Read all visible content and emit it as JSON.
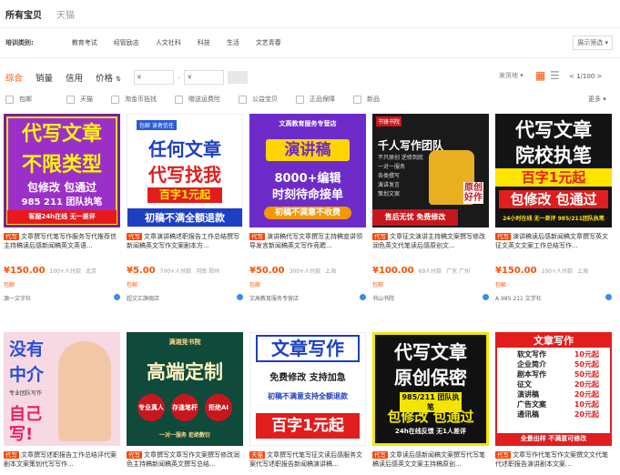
{
  "tabs": [
    "所有宝贝",
    "天猫"
  ],
  "category": {
    "label": "培训类别:",
    "items": [
      "教育考试",
      "经管励志",
      "人文社科",
      "科技",
      "生活",
      "文艺青春"
    ],
    "more": "展示筛选 ▾"
  },
  "sort": {
    "items": [
      "综合",
      "销量",
      "信用",
      "价格"
    ],
    "price_from": "¥",
    "price_to": "¥"
  },
  "shipping_filter": "发货地 ▾",
  "pager": "< 1/100 >",
  "filters": [
    "包邮",
    "天猫",
    "淘金币抵钱",
    "赠送运费险",
    "公益宝贝",
    "正品保障",
    "新品"
  ],
  "filters_more": "更多 ▾",
  "colors": {
    "accent": "#ff5000",
    "blue": "#3a8ee6"
  },
  "products": [
    {
      "img": {
        "l1": "代写文章",
        "l2": "不限类型",
        "l3": "包修改 包通过",
        "l4": "985 211 团队执笔",
        "l5": "客服24h在线    无一差评"
      },
      "ad": "代写",
      "title": "文章撰写代笔写作服务写代推荐信主持稿读后感新闻稿英文英语...",
      "price": "¥150.00",
      "paid": "100+人付款",
      "loc": "北京",
      "ship": "包邮",
      "shop": "源一文字社"
    },
    {
      "img": {
        "tag": "包邮 读者信任",
        "l1": "任何文章",
        "l2": "代写找我",
        "l3": "百字1元起",
        "l4": "初稿不满全额退款"
      },
      "ad": "代写",
      "title": "文章演讲稿述职报告工作总结撰写新闻稿英文写作文案剧本方...",
      "price": "¥5.00",
      "paid": "700+人付款",
      "loc": "河南 郑州",
      "ship": "包邮",
      "shop": "超文汇旗舰店"
    },
    {
      "img": {
        "tag": "文高教育服务专营店",
        "l1": "演讲稿",
        "l2": "8000+编辑",
        "l3": "时刻待命接单",
        "l4": "初稿不满意不收费"
      },
      "ad": "代写",
      "title": "演讲稿代写文章撰写主持稿宣讲领导发言新闻稿英文写作竞聘...",
      "price": "¥50.00",
      "paid": "300+人付款",
      "loc": "上海",
      "ship": "包邮",
      "shop": "文高教育服务专营店"
    },
    {
      "img": {
        "tag": "书锋书院",
        "l1": "千人写作团队",
        "l2": "原创好作",
        "l3": "售后无忧 免费修改",
        "items": "不只原创 逆修到底\n一对一服务\n各类撰写\n演讲发言\n策划文案"
      },
      "ad": "代写",
      "title": "文章征文演讲主持稿文案撰写修改润色英文代笔读后感原创文...",
      "price": "¥100.00",
      "paid": "69人付款",
      "loc": "广东 广州",
      "ship": "包邮",
      "shop": "书山书院"
    },
    {
      "img": {
        "l1": "代写文章",
        "l2": "院校执笔",
        "l3": "百字1元起",
        "l4": "包修改 包通过",
        "l5": "24小时在线 无一差评 985/211团队执笔"
      },
      "ad": "代写",
      "title": "演讲稿读后感新闻稿文章撰写英文征文英文文案工作总结写作...",
      "price": "¥150.00",
      "paid": "100+人付款",
      "loc": "上海",
      "ship": "包邮",
      "shop": "A 985 211 文学社"
    },
    {
      "img": {
        "l1": "没有",
        "l2": "中介",
        "l3": "自己",
        "l4": "写!",
        "l5": "专业团队写作"
      },
      "ad": "代写",
      "title": "文章撰写述职报告工作总结评代案剧本文案策划代写写作...",
      "price": "",
      "paid": "",
      "loc": "",
      "ship": "",
      "shop": ""
    },
    {
      "img": {
        "tag": "满湘竞书院",
        "l1": "高端定制",
        "b1": "专业真人",
        "b2": "存逢笔杆",
        "b3": "拒绝AI",
        "l2": "一对一服务  拒绝敷衍"
      },
      "ad": "代写",
      "title": "文章撰写文章写作文案撰写修改润色主持稿新闻稿英文撰写总结...",
      "price": "",
      "paid": "",
      "loc": "",
      "ship": "",
      "shop": ""
    },
    {
      "img": {
        "l1": "文章写作",
        "l2": "免费修改  支持加急",
        "l3": "初稿不满意支持全额退款",
        "l4": "百字1元起"
      },
      "ad": "天猫",
      "title": "文章撰写代笔写征文读后感服务文案代写述职报告新闻稿演讲稿...",
      "price": "",
      "paid": "",
      "loc": "",
      "ship": "",
      "shop": ""
    },
    {
      "img": {
        "l1": "代写文章",
        "l2": "原创保密",
        "l3": "985/211  团队执笔",
        "l4": "包修改  包通过",
        "l5": "24h在线反馈  无1人差评"
      },
      "ad": "代写",
      "title": "文章读后感新闻稿文案撰写代写笔稿读后感英文文案主持稿原创...",
      "price": "",
      "paid": "",
      "loc": "",
      "ship": "",
      "shop": ""
    },
    {
      "img": {
        "title": "文章写作",
        "rows": [
          [
            "软文写作",
            "10元起"
          ],
          [
            "企业简介",
            "50元起"
          ],
          [
            "剧本写作",
            "50元起"
          ],
          [
            "征文",
            "20元起"
          ],
          [
            "演讲稿",
            "20元起"
          ],
          [
            "广告文案",
            "10元起"
          ],
          [
            "通讯稿",
            "20元起"
          ]
        ],
        "foot": "全景出样 不满意可修改"
      },
      "ad": "代写",
      "title": "文章写作代笔写作文案撰文文代笔代述职报告演讲剧本文案...",
      "price": "",
      "paid": "",
      "loc": "",
      "ship": "",
      "shop": ""
    }
  ]
}
